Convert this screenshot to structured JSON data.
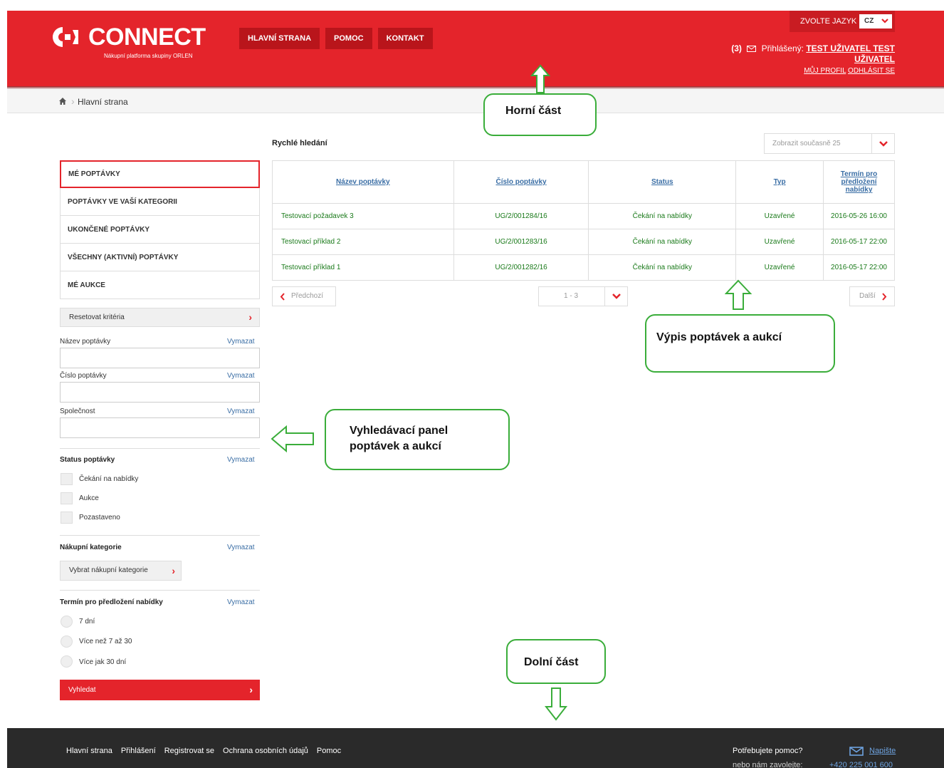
{
  "header": {
    "logo_text": "CONNECT",
    "logo_sub": "Nákupní platforma skupiny ORLEN",
    "nav": [
      "HLAVNÍ STRANA",
      "POMOC",
      "KONTAKT"
    ],
    "lang_label": "ZVOLTE JAZYK",
    "lang_value": "CZ",
    "msg_count": "(3)",
    "logged_label": "Přihlášený:",
    "user_name_1": "TEST UŽIVATEL TEST",
    "user_name_2": "UŽIVATEL",
    "profile_link": "MŮJ PROFIL",
    "logout_link": "ODHLÁSIT SE"
  },
  "breadcrumb": {
    "current": "Hlavní strana"
  },
  "sidebar": {
    "tabs": [
      "MÉ POPTÁVKY",
      "POPTÁVKY VE VAŠÍ KATEGORII",
      "UKONČENÉ POPTÁVKY",
      "VŠECHNY (AKTIVNÍ) POPTÁVKY",
      "MÉ AUKCE"
    ],
    "reset": "Resetovat kritéria",
    "clear": "Vymazat",
    "field_name": "Název poptávky",
    "field_number": "Číslo poptávky",
    "field_company": "Společnost",
    "status_title": "Status poptávky",
    "status_options": [
      "Čekání na nabídky",
      "Aukce",
      "Pozastaveno"
    ],
    "category_title": "Nákupní kategorie",
    "category_button": "Vybrat nákupní kategorie",
    "deadline_title": "Termín pro předložení nabídky",
    "deadline_options": [
      "7 dní",
      "Více než 7 až 30",
      "Více jak 30 dní"
    ],
    "search_button": "Vyhledat"
  },
  "main": {
    "quick_search": "Rychlé hledání",
    "per_page": "Zobrazit současně 25",
    "columns": [
      "Název poptávky",
      "Číslo poptávky",
      "Status",
      "Typ",
      "Termín pro předložení nabídky"
    ],
    "rows": [
      [
        "Testovací požadavek 3",
        "UG/2/001284/16",
        "Čekání na nabídky",
        "Uzavřené",
        "2016-05-26 16:00"
      ],
      [
        "Testovací příklad 2",
        "UG/2/001283/16",
        "Čekání na nabídky",
        "Uzavřené",
        "2016-05-17 22:00"
      ],
      [
        "Testovací příklad 1",
        "UG/2/001282/16",
        "Čekání na nabídky",
        "Uzavřené",
        "2016-05-17 22:00"
      ]
    ],
    "prev": "Předchozí",
    "next": "Další",
    "page_range": "1 - 3"
  },
  "callouts": {
    "top": "Horní část",
    "list": "Výpis poptávek a aukcí",
    "search_panel": "Vyhledávací panel poptávek a aukcí",
    "bottom": "Dolní část"
  },
  "footer": {
    "links": [
      "Hlavní strana",
      "Přihlášení",
      "Registrovat se",
      "Ochrana osobních údajů",
      "Pomoc"
    ],
    "help": "Potřebujete pomoc?",
    "write": "Napište",
    "call": "nebo nám zavolejte:",
    "phone": "+420 225 001 600"
  },
  "colors": {
    "brand_red": "#e4242b",
    "callout_green": "#3aad3a",
    "footer_dark": "#2a2a2a"
  }
}
